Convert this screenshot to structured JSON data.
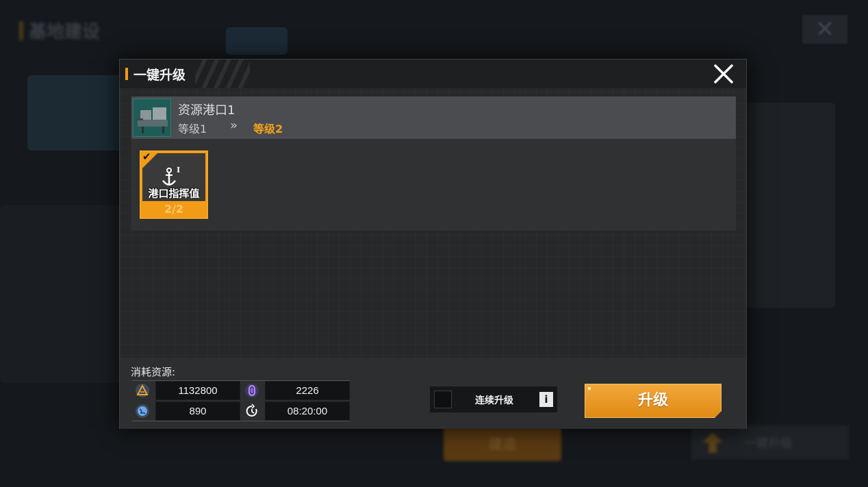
{
  "background": {
    "page_title": "基地建设",
    "bottom_button": "建造",
    "right_button": "一键升级"
  },
  "dialog": {
    "title": "一键升级",
    "close_icon": "close-icon",
    "building": {
      "name": "资源港口1",
      "level_from": "等级1",
      "arrow": "»",
      "level_to": "等级2"
    },
    "requirement": {
      "label": "港口指挥值",
      "count": "2/2",
      "checked": true,
      "icon": "anchor-icon"
    },
    "cost_label": "消耗资源:",
    "costs": [
      {
        "icon": "warning-triangle-icon",
        "value": "1132800"
      },
      {
        "icon": "crystal-icon",
        "value": "2226"
      },
      {
        "icon": "globe-icon",
        "value": "890"
      },
      {
        "icon": "timer-icon",
        "value": "08:20:00"
      }
    ],
    "continuous": {
      "label": "连续升级",
      "checked": false,
      "info": "i"
    },
    "upgrade_button": "升级"
  },
  "colors": {
    "accent": "#f29b16",
    "level_up": "#f2a21a"
  }
}
